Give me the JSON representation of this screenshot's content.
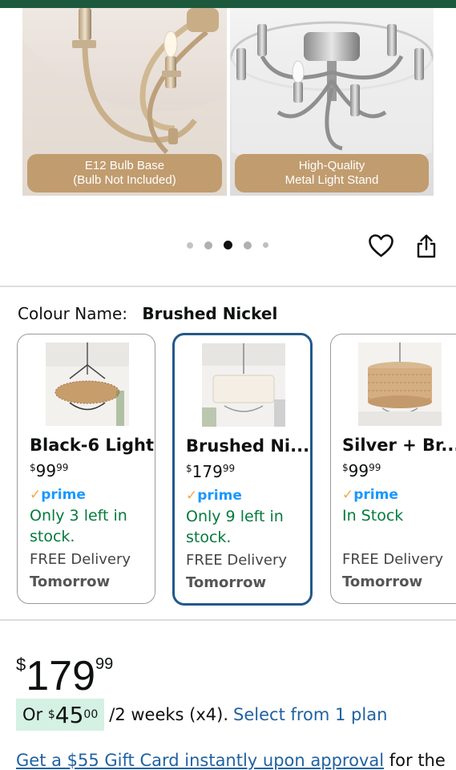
{
  "gallery": {
    "images": [
      {
        "caption_line1": "E12 Bulb Base",
        "caption_line2": "(Bulb Not Included)"
      },
      {
        "caption_line1": "High-Quality",
        "caption_line2": "Metal Light Stand"
      }
    ],
    "dots": 5,
    "active_dot": 3
  },
  "actions": {
    "favorite_icon": "heart-icon",
    "share_icon": "share-icon"
  },
  "colour": {
    "label": "Colour Name:",
    "value": "Brushed Nickel"
  },
  "variants": [
    {
      "title": "Black-6 Light",
      "price_currency": "$",
      "price_whole": "99",
      "price_cents": "99",
      "prime": "prime",
      "stock": "Only 3 left in stock.",
      "delivery": "FREE Delivery",
      "delivery_day": "Tomorrow",
      "selected": false
    },
    {
      "title": "Brushed Ni...",
      "price_currency": "$",
      "price_whole": "179",
      "price_cents": "99",
      "prime": "prime",
      "stock": "Only 9 left in stock.",
      "delivery": "FREE Delivery",
      "delivery_day": "Tomorrow",
      "selected": true
    },
    {
      "title": "Silver + Br...",
      "price_currency": "$",
      "price_whole": "99",
      "price_cents": "99",
      "prime": "prime",
      "stock": "In Stock",
      "delivery": "FREE Delivery",
      "delivery_day": "Tomorrow",
      "selected": false
    }
  ],
  "price": {
    "currency": "$",
    "whole": "179",
    "cents": "99"
  },
  "installment": {
    "prefix": "Or",
    "currency": "$",
    "amount": "45",
    "cents": "00",
    "period": "/2 weeks (x4).",
    "link": "Select from 1 plan"
  },
  "gift": {
    "link": "Get a $55 Gift Card instantly upon approval",
    "suffix": "for the"
  },
  "colors": {
    "prime_blue": "#1a98ff",
    "stock_green": "#057a3d",
    "link_blue": "#2162a1",
    "selected_border": "#23588a",
    "installment_bg": "#d4f1e4",
    "caption_bg": "#c19c6f"
  }
}
